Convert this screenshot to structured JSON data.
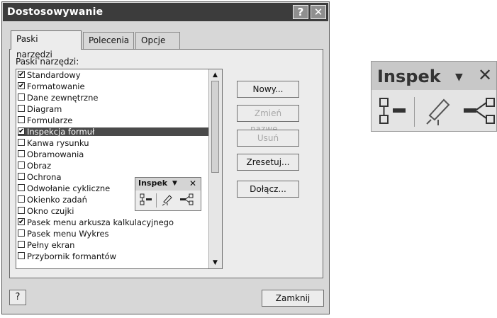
{
  "dialog": {
    "title": "Dostosowywanie",
    "help_button": "?",
    "close_button": "✕"
  },
  "tabs": [
    {
      "label": "Paski narzędzi",
      "active": true
    },
    {
      "label": "Polecenia",
      "active": false
    },
    {
      "label": "Opcje",
      "active": false
    }
  ],
  "toolbars_label": "Paski narzędzi:",
  "toolbar_list": [
    {
      "label": "Standardowy",
      "checked": true,
      "selected": false
    },
    {
      "label": "Formatowanie",
      "checked": true,
      "selected": false
    },
    {
      "label": "Dane zewnętrzne",
      "checked": false,
      "selected": false
    },
    {
      "label": "Diagram",
      "checked": false,
      "selected": false
    },
    {
      "label": "Formularze",
      "checked": false,
      "selected": false
    },
    {
      "label": "Inspekcja formuł",
      "checked": true,
      "selected": true
    },
    {
      "label": "Kanwa rysunku",
      "checked": false,
      "selected": false
    },
    {
      "label": "Obramowania",
      "checked": false,
      "selected": false
    },
    {
      "label": "Obraz",
      "checked": false,
      "selected": false
    },
    {
      "label": "Ochrona",
      "checked": false,
      "selected": false
    },
    {
      "label": "Odwołanie cykliczne",
      "checked": false,
      "selected": false
    },
    {
      "label": "Okienko zadań",
      "checked": false,
      "selected": false
    },
    {
      "label": "Okno czujki",
      "checked": false,
      "selected": false
    },
    {
      "label": "Pasek menu arkusza kalkulacyjnego",
      "checked": true,
      "selected": false
    },
    {
      "label": "Pasek menu Wykres",
      "checked": false,
      "selected": false
    },
    {
      "label": "Pełny ekran",
      "checked": false,
      "selected": false
    },
    {
      "label": "Przybornik formantów",
      "checked": false,
      "selected": false
    }
  ],
  "buttons": {
    "new": "Nowy...",
    "rename": "Zmień nazwę...",
    "delete": "Usuń",
    "reset": "Zresetuj...",
    "attach": "Dołącz...",
    "close": "Zamknij"
  },
  "floating_toolbar": {
    "title": "Inspek",
    "dropdown": "▼",
    "close": "✕"
  },
  "big_toolbar": {
    "title": "Inspek",
    "dropdown": "▼",
    "close": "✕"
  }
}
